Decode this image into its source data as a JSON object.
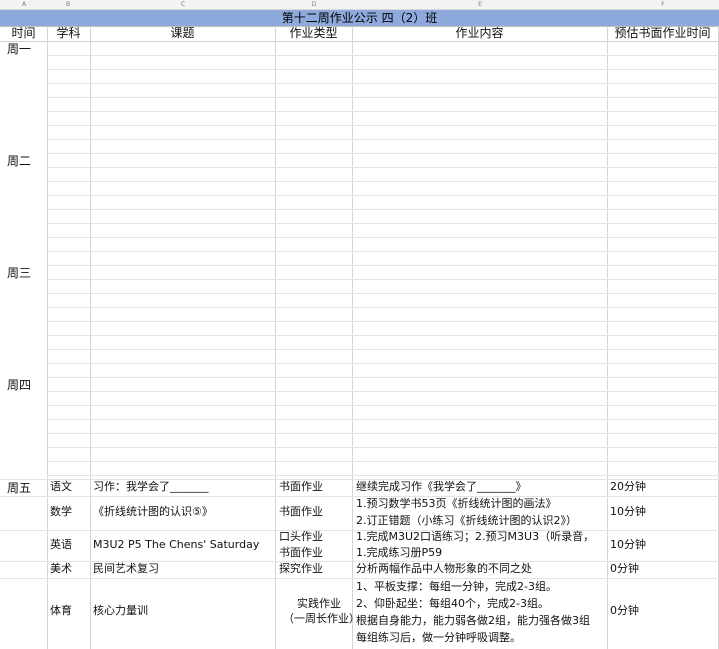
{
  "column_letters": [
    "A",
    "B",
    "C",
    "D",
    "E",
    "F"
  ],
  "title": "第十二周作业公示 四（2）班",
  "headers": [
    "时间",
    "学科",
    "课题",
    "作业类型",
    "作业内容",
    "预估书面作业时间"
  ],
  "days": [
    "周一",
    "周二",
    "周三",
    "周四",
    "周五"
  ],
  "friday_rows": [
    {
      "subject": "语文",
      "topic": "习作：我学会了_______",
      "type": [
        "书面作业"
      ],
      "content": [
        "继续完成习作《我学会了_______》"
      ],
      "time": "20分钟"
    },
    {
      "subject": "数学",
      "topic": "《折线统计图的认识⑤》",
      "type": [
        "书面作业"
      ],
      "content": [
        "1.预习数学书53页《折线统计图的画法》",
        "2.订正错题（小练习《折线统计图的认识2》）"
      ],
      "time": "10分钟"
    },
    {
      "subject": "英语",
      "topic": "M3U2 P5 The Chens' Saturday",
      "type": [
        "口头作业",
        "书面作业"
      ],
      "content": [
        "1.完成M3U2口语练习；2.预习M3U3（听录音，",
        "1.完成练习册P59"
      ],
      "time": "10分钟"
    },
    {
      "subject": "美术",
      "topic": "民间艺术复习",
      "type": [
        "探究作业"
      ],
      "content": [
        "分析两幅作品中人物形象的不同之处"
      ],
      "time": "0分钟"
    },
    {
      "subject": "体育",
      "topic": "核心力量训",
      "type": [
        "实践作业",
        "（一周长作业）"
      ],
      "content": [
        "1、平板支撑：每组一分钟，完成2-3组。",
        "2、仰卧起坐：每组40个，完成2-3组。",
        "根据自身能力，能力弱各做2组，能力强各做3组",
        "每组练习后，做一分钟呼吸调整。"
      ],
      "time": "0分钟"
    }
  ]
}
